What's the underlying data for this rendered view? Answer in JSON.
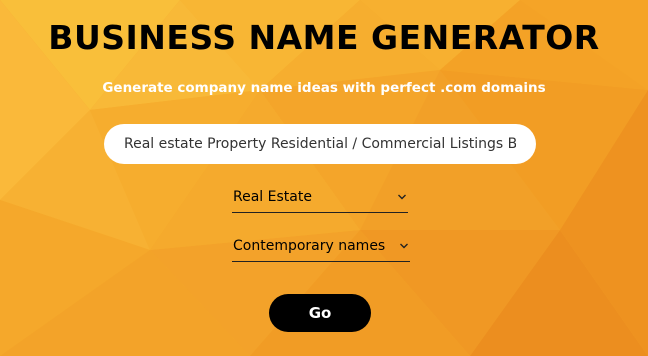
{
  "header": {
    "title": "BUSINESS NAME GENERATOR",
    "subtitle": "Generate company name ideas with perfect .com domains"
  },
  "search": {
    "value": "Real estate Property Residential / Commercial Listings Bro"
  },
  "industry_select": {
    "selected": "Real Estate",
    "icon": "chevron-down-icon"
  },
  "style_select": {
    "selected": "Contemporary names",
    "icon": "chevron-down-icon"
  },
  "go_button": {
    "label": "Go"
  },
  "colors": {
    "background": "#f6aa2a",
    "title": "#000000",
    "subtitle": "#ffffff",
    "button_bg": "#000000",
    "button_text": "#ffffff"
  }
}
